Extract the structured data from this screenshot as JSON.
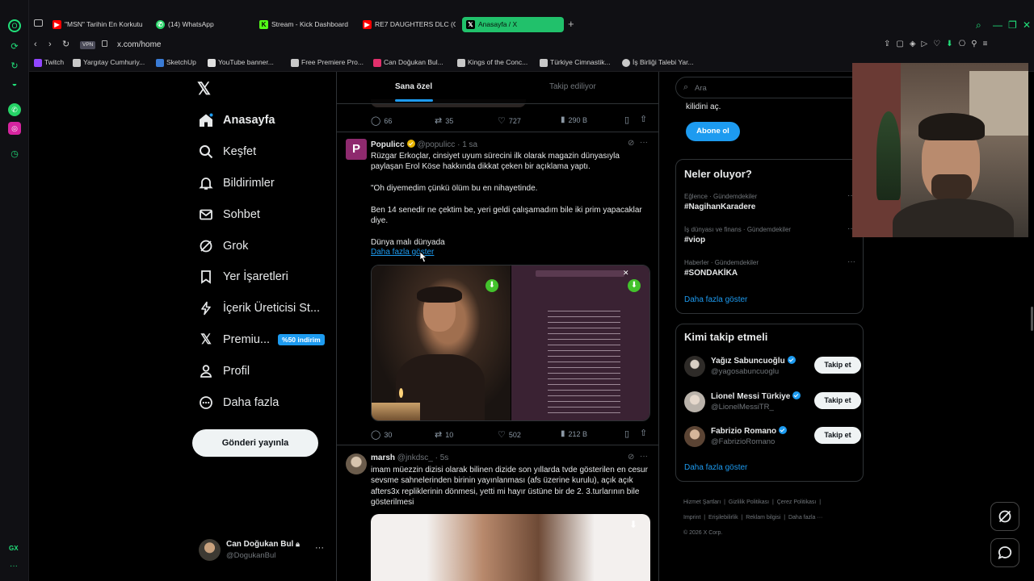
{
  "browser": {
    "tabs": [
      {
        "label": "\"MSN\" Tarihin En Korkutu",
        "icon": "youtube-icon",
        "color": "#ff0000"
      },
      {
        "label": "(14) WhatsApp",
        "icon": "whatsapp-icon",
        "color": "#25d366"
      },
      {
        "label": "Stream - Kick Dashboard",
        "icon": "kick-icon",
        "color": "#53fc18"
      },
      {
        "label": "RE7 DAUGHTERS DLC (Gi",
        "icon": "youtube-icon",
        "color": "#ff0000"
      },
      {
        "label": "Anasayfa / X",
        "icon": "x-icon",
        "color": "#000000"
      }
    ],
    "new_tab": "+",
    "vpn": "VPN",
    "url": "x.com/home",
    "bookmarks": [
      {
        "label": "Twitch",
        "color": "#9146ff"
      },
      {
        "label": "Yargıtay Cumhuriy...",
        "color": "#c8c8c8"
      },
      {
        "label": "SketchUp",
        "color": "#3a7bd5"
      },
      {
        "label": "YouTube banner...",
        "color": "#e0e0e0"
      },
      {
        "label": "Free Premiere Pro...",
        "color": "#c8c8c8"
      },
      {
        "label": "Can Doğukan Bul...",
        "color": "#e1306c"
      },
      {
        "label": "Kings of the Conc...",
        "color": "#c8c8c8"
      },
      {
        "label": "Türkiye Cimnastik...",
        "color": "#c8c8c8"
      },
      {
        "label": "İş Birliği Talebi Yar...",
        "color": "#c8c8c8"
      }
    ],
    "sidebar_bottom": "GX",
    "accent": "#21c16b"
  },
  "nav": {
    "items": [
      {
        "label": "Anasayfa",
        "icon": "home-icon"
      },
      {
        "label": "Keşfet",
        "icon": "search-icon"
      },
      {
        "label": "Bildirimler",
        "icon": "bell-icon"
      },
      {
        "label": "Sohbet",
        "icon": "mail-icon"
      },
      {
        "label": "Grok",
        "icon": "grok-icon"
      },
      {
        "label": "Yer İşaretleri",
        "icon": "bookmark-icon"
      },
      {
        "label": "İçerik Üreticisi St...",
        "icon": "lightning-icon"
      },
      {
        "label": "Premiu...",
        "icon": "x-icon",
        "badge": "%50 indirim"
      },
      {
        "label": "Profil",
        "icon": "person-icon"
      },
      {
        "label": "Daha fazla",
        "icon": "more-circle-icon"
      }
    ],
    "post_button": "Gönderi yayınla",
    "account": {
      "name": "Can Doğukan Bul",
      "handle": "@DogukanBul",
      "more": "···"
    }
  },
  "feed": {
    "tabs": [
      {
        "label": "Sana özel",
        "active": true
      },
      {
        "label": "Takip ediliyor",
        "active": false
      }
    ],
    "prev_stats": {
      "replies": "66",
      "reposts": "35",
      "likes": "727",
      "views": "290 B"
    },
    "tweet1": {
      "author": "Populicc",
      "handle": "@populicc",
      "time": "· 1 sa",
      "avatar_letter": "P",
      "lines": [
        "Rüzgar Erkoçlar, cinsiyet uyum sürecini ilk olarak magazin dünyasıyla paylaşan Erol Köse hakkında dikkat çeken bir açıklama yaptı.",
        "\"Oh diyemedim çünkü ölüm bu en nihayetinde.",
        "Ben 14 senedir ne çektim be, yeri geldi çalışamadım bile iki prim yapacaklar diye.",
        "Dünya malı dünyada"
      ],
      "show_more": "Daha fazla göster",
      "stats": {
        "replies": "30",
        "reposts": "10",
        "likes": "502",
        "views": "212 B"
      }
    },
    "tweet2": {
      "author": "marsh",
      "handle": "@jnkdsc_",
      "time": "· 5s",
      "text": "imam müezzin dizisi olarak bilinen dizide son yıllarda tvde gösterilen en cesur sevsme sahnelerinden birinin yayınlanması (afs üzerine kurulu), açık açık afters3x repliklerinin dönmesi, yetti mi hayır üstüne bir de 2. 3.turlarının bile gösterilmesi"
    }
  },
  "right": {
    "search_placeholder": "Ara",
    "premium_tail": "kilidini aç.",
    "subscribe": "Abone ol",
    "trends_title": "Neler oluyor?",
    "trends": [
      {
        "context": "Eğlence · Gündemdekiler",
        "name": "#NagihanKaradere"
      },
      {
        "context": "İş dünyası ve finans · Gündemdekiler",
        "name": "#viop"
      },
      {
        "context": "Haberler · Gündemdekiler",
        "name": "#SONDAKİKA"
      }
    ],
    "trends_more": "Daha fazla göster",
    "who_title": "Kimi takip etmeli",
    "who": [
      {
        "name": "Yağız Sabuncuoğlu",
        "handle": "@yagosabuncuoglu",
        "follow": "Takip et"
      },
      {
        "name": "Lionel Messi Türkiye",
        "handle": "@LionelMessiTR_",
        "follow": "Takip et"
      },
      {
        "name": "Fabrizio Romano",
        "handle": "@FabrizioRomano",
        "follow": "Takip et"
      }
    ],
    "who_more": "Daha fazla göster",
    "footer": [
      "Hizmet Şartları",
      "Gizlilik Politikası",
      "Çerez Politikası",
      "Imprint",
      "Erişilebilirlik",
      "Reklam bilgisi",
      "Daha fazla ···",
      "© 2026 X Corp."
    ]
  }
}
